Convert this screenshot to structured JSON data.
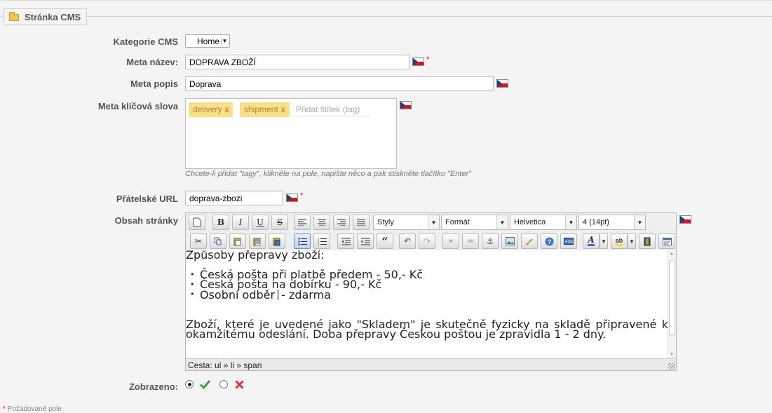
{
  "section": {
    "title": "Stránka CMS"
  },
  "labels": {
    "category": "Kategorie CMS",
    "meta_title": "Meta název:",
    "meta_desc": "Meta popis",
    "meta_keywords": "Meta klíčová slova",
    "friendly_url": "Přátelské URL",
    "content": "Obsah stránky",
    "displayed": "Zobrazeno:"
  },
  "fields": {
    "category_value": "Home",
    "meta_title_value": "DOPRAVA ZBOŽÍ",
    "meta_desc_value": "Doprava",
    "tags": [
      {
        "label": "delivery",
        "remove": "x"
      },
      {
        "label": "shipment",
        "remove": "x"
      }
    ],
    "tag_placeholder": "Přidat štítek (tag)",
    "tag_hint": "Chcete-li přidat \"tagy\", klikněte na pole, napište něco a pak stiskněte tlačítko \"Enter\"",
    "friendly_url_value": "doprava-zbozi",
    "required_mark": "*"
  },
  "editor": {
    "toolbar": {
      "styles": "Styly",
      "format": "Formát",
      "font": "Helvetica",
      "size": "4 (14pt)"
    },
    "content": {
      "heading": "Způsoby přepravy zboží:",
      "items": [
        "Česká pošta při platbě předem - 50,- Kč",
        "Česká pošta na dobírku - 90,- Kč",
        "Osobní odběr",
        "- zdarma"
      ],
      "paragraph": "Zboží, které je uvedené jako \"Skladem\" je skutečně fyzicky na skladě připravené k okamžitému odeslání. Doba přepravy Českou poštou je zpravidla 1 - 2 dny."
    },
    "path": "Cesta: ul » li » span"
  },
  "footnote": {
    "star": "*",
    "text": " Požadované pole"
  },
  "colors": {
    "accent": "#fbe08a",
    "tag_text": "#a98a2a",
    "remove": "#e05a00",
    "yes": "#3ca23c",
    "no": "#e03030"
  }
}
